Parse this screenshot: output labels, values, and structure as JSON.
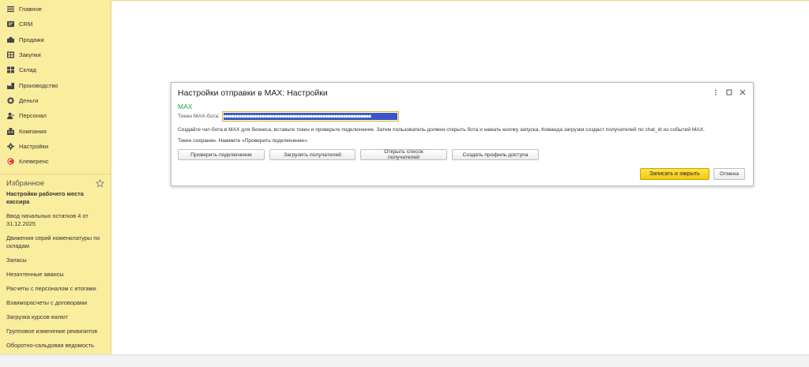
{
  "sidebar": {
    "nav": [
      {
        "label": "Главное",
        "icon": "menu-icon"
      },
      {
        "label": "CRM",
        "icon": "crm-icon"
      },
      {
        "label": "Продажи",
        "icon": "sales-icon"
      },
      {
        "label": "Закупки",
        "icon": "purchases-icon"
      },
      {
        "label": "Склад",
        "icon": "warehouse-icon"
      },
      {
        "label": "Производство",
        "icon": "production-icon"
      },
      {
        "label": "Деньги",
        "icon": "money-icon"
      },
      {
        "label": "Персонал",
        "icon": "staff-icon"
      },
      {
        "label": "Компания",
        "icon": "company-icon"
      },
      {
        "label": "Настройки",
        "icon": "gear-icon"
      },
      {
        "label": "Клеверенс",
        "icon": "cleverence-icon"
      }
    ],
    "favorites_title": "Избранное",
    "favorites": [
      {
        "label": "Настройки рабочего места кассира",
        "bold": true
      },
      {
        "label": "Ввод начальных остатков 4 от 31.12.2025"
      },
      {
        "label": "Движения серий номенклатуры по складам"
      },
      {
        "label": "Запасы"
      },
      {
        "label": "Незачтенные авансы"
      },
      {
        "label": "Расчеты с персоналом с итогами"
      },
      {
        "label": "Взаиморасчеты с договорами"
      },
      {
        "label": "Загрузка курсов валют"
      },
      {
        "label": "Групповое изменение реквизитов"
      },
      {
        "label": "Оборотно-сальдовая ведомость"
      }
    ]
  },
  "dialog": {
    "title": "Настройки отправки в MAX: Настройки",
    "section": "MAX",
    "token_label": "Токен MAX-бота:",
    "token_value": "●●●●●●●●●●●●●●●●●●●●●●●●●●●●●●●●●●●●●●●●●●●●●●●●●●●●●●●●●●",
    "help_text": "Создайте чат-бота в MAX для бизнеса, вставьте токен и проверьте подключение. Затем пользователь должен открыть бота и нажать кнопку запуска. Команда загрузки создаст получателей по chat_id из событий MAX.",
    "saved_text": "Токен сохранен. Нажмите «Проверить подключение».",
    "buttons": {
      "check": "Проверить подключение",
      "load": "Загрузить получателей",
      "open_list": "Открыть список получателей",
      "create_profile": "Создать профиль доступа",
      "save_close": "Записать и закрыть",
      "cancel": "Отмена"
    }
  },
  "colors": {
    "sidebar_bg": "#fbed9e",
    "section_title": "#22a046",
    "token_highlight": "#3957c4",
    "primary_button": "#f6cf1e"
  }
}
